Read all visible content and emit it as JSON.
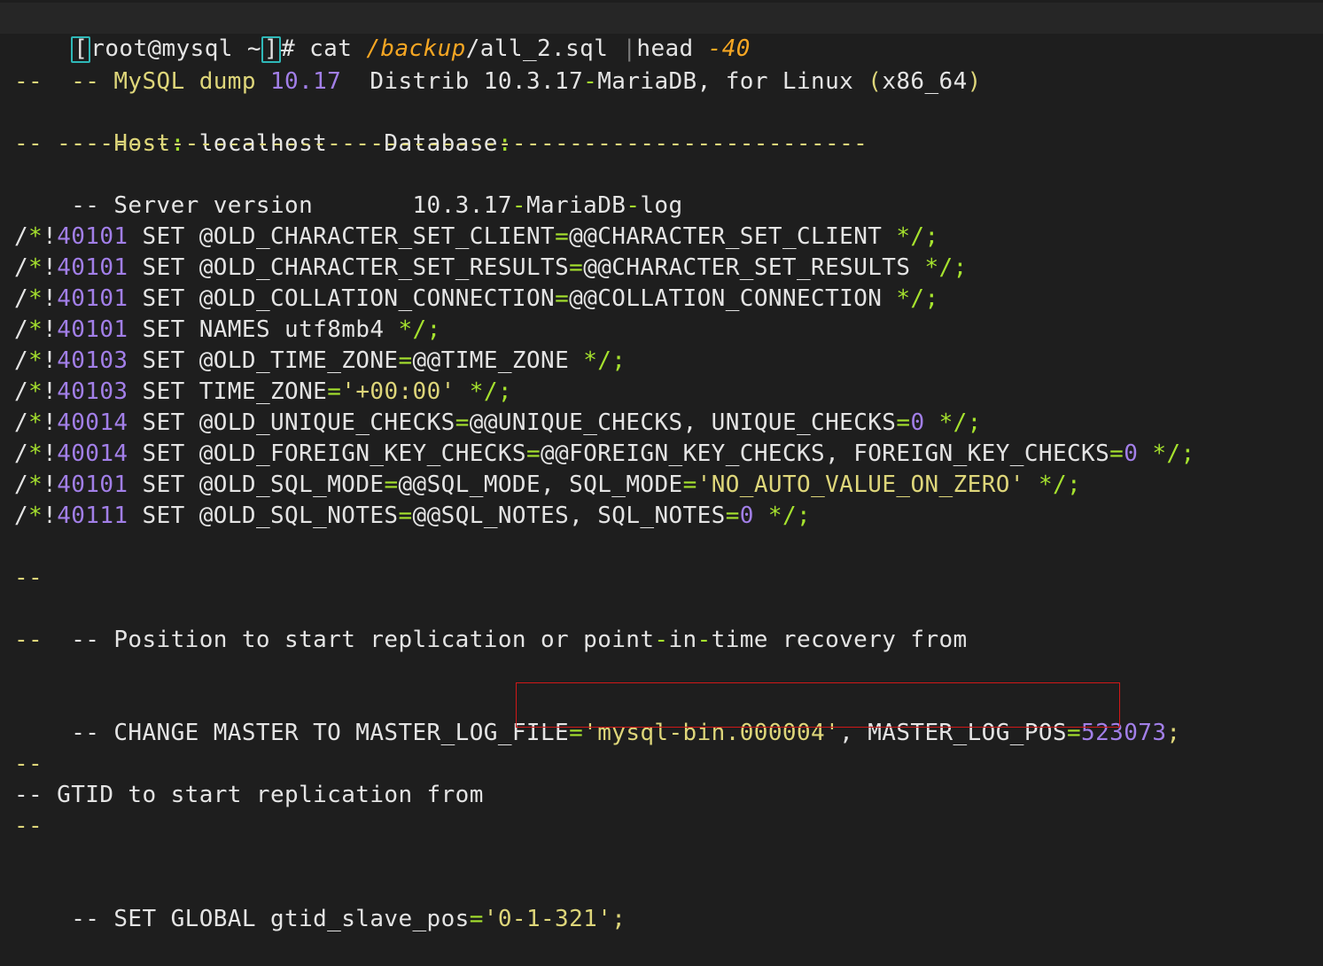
{
  "prompt": {
    "open_bracket": "[",
    "user_host": "root@mysql",
    "dir": " ~",
    "close_bracket": "]",
    "hash": "# ",
    "command": "cat ",
    "path_slash1": "/",
    "path_dir": "backup",
    "path_slash2": "/",
    "path_file": "all_2.sql ",
    "pipe": "|",
    "pipe_cmd": "head ",
    "pipe_arg": "-40"
  },
  "header": {
    "line1": {
      "prefix": "-- MySQL dump ",
      "ver": "10.17",
      "mid": "  Distrib 10.3.17",
      "dash": "-",
      "rest": "MariaDB, for Linux ",
      "paren_open": "(",
      "arch": "x86_64",
      "paren_close": ")"
    },
    "line2": "--",
    "line3": {
      "prefix": "-- Host",
      "colon1": ":",
      "host": " localhost    Database",
      "colon2": ":"
    },
    "line4": "-- ---------------------------------------------------------",
    "line5": {
      "prefix": "-- Server version       10.3.17",
      "dash1": "-",
      "mid": "MariaDB",
      "dash2": "-",
      "rest": "log"
    }
  },
  "set_lines": [
    {
      "ver": "40101",
      "body": " SET @OLD_CHARACTER_SET_CLIENT",
      "eq": "=",
      "val": "@@CHARACTER_SET_CLIENT ",
      "end": "*/;"
    },
    {
      "ver": "40101",
      "body": " SET @OLD_CHARACTER_SET_RESULTS",
      "eq": "=",
      "val": "@@CHARACTER_SET_RESULTS ",
      "end": "*/;"
    },
    {
      "ver": "40101",
      "body": " SET @OLD_COLLATION_CONNECTION",
      "eq": "=",
      "val": "@@COLLATION_CONNECTION ",
      "end": "*/;"
    },
    {
      "ver": "40101",
      "body": " SET NAMES utf8mb4 ",
      "eq": "",
      "val": "",
      "end": "*/;"
    },
    {
      "ver": "40103",
      "body": " SET @OLD_TIME_ZONE",
      "eq": "=",
      "val": "@@TIME_ZONE ",
      "end": "*/;"
    },
    {
      "ver": "40103",
      "body": " SET TIME_ZONE",
      "eq": "=",
      "val": "",
      "str": "'+00:00'",
      "tail": " ",
      "end": "*/;"
    },
    {
      "ver": "40014",
      "body": " SET @OLD_UNIQUE_CHECKS",
      "eq": "=",
      "val": "@@UNIQUE_CHECKS, UNIQUE_CHECKS",
      "eq2": "=",
      "num": "0",
      "tail": " ",
      "end": "*/;"
    },
    {
      "ver": "40014",
      "body": " SET @OLD_FOREIGN_KEY_CHECKS",
      "eq": "=",
      "val": "@@FOREIGN_KEY_CHECKS, FOREIGN_KEY_CHECKS",
      "eq2": "=",
      "num": "0",
      "tail": " ",
      "end": "*/;"
    },
    {
      "ver": "40101",
      "body": " SET @OLD_SQL_MODE",
      "eq": "=",
      "val": "@@SQL_MODE, SQL_MODE",
      "eq2": "=",
      "str": "'NO_AUTO_VALUE_ON_ZERO'",
      "tail": " ",
      "end": "*/;"
    },
    {
      "ver": "40111",
      "body": " SET @OLD_SQL_NOTES",
      "eq": "=",
      "val": "@@SQL_NOTES, SQL_NOTES",
      "eq2": "=",
      "num": "0",
      "tail": " ",
      "end": "*/;"
    }
  ],
  "comment_prefix": "/",
  "comment_star": "*",
  "comment_bang": "!",
  "position": {
    "dash_a": "--",
    "title_parts": [
      "-- Position to start replication or point",
      "-",
      "in",
      "-",
      "time recovery from"
    ],
    "dash_b": "--"
  },
  "change_master": {
    "prefix": "-- CHANGE MASTER TO MASTER_LOG_FILE",
    "eq1": "=",
    "file": "'mysql-bin.000004'",
    "mid": ", MASTER_LOG_POS",
    "eq2": "=",
    "pos": "523073",
    "semi": ";"
  },
  "gtid": {
    "dash_a": "--",
    "title": "-- GTID to start replication from",
    "dash_b": "--",
    "set_prefix": "-- SET GLOBAL gtid_slave_pos",
    "eq": "=",
    "value": "'0-1-321'",
    "semi": ";"
  }
}
